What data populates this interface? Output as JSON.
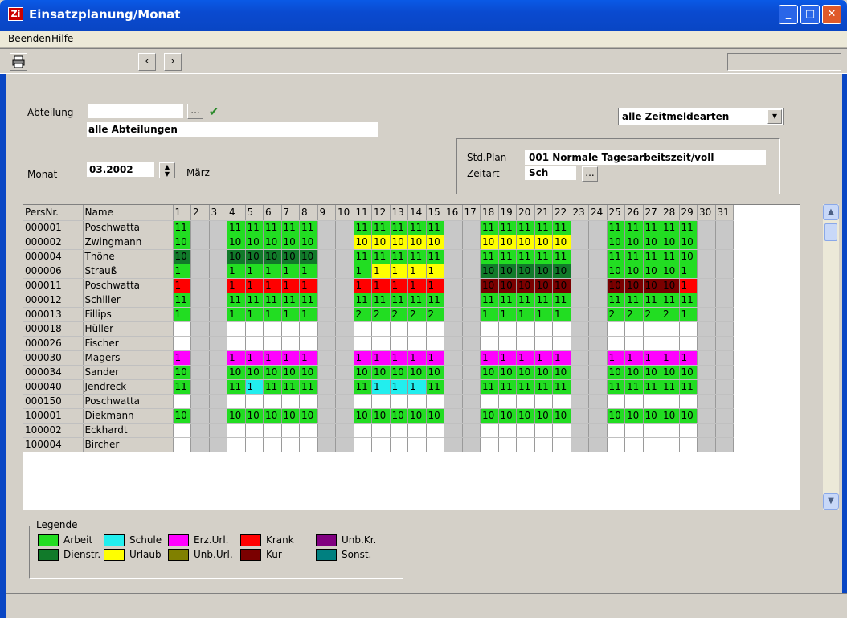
{
  "window": {
    "title": "Einsatzplanung/Monat",
    "app_icon_label": "Zi"
  },
  "menu": [
    "Beenden",
    "Hilfe"
  ],
  "filters": {
    "abteilung_label": "Abteilung",
    "abteilung_value": "",
    "abteilung_name": "alle Abteilungen",
    "monat_label": "Monat",
    "monat_value": "03.2002",
    "monat_name": "März",
    "zeitmeldeart": "alle Zeitmeldearten",
    "stdplan_label": "Std.Plan",
    "stdplan_value": "001 Normale Tagesarbeitszeit/voll",
    "zeitart_label": "Zeitart",
    "zeitart_value": "Sch"
  },
  "grid": {
    "col_persnr": "PersNr.",
    "col_name": "Name",
    "days": [
      "1",
      "2",
      "3",
      "4",
      "5",
      "6",
      "7",
      "8",
      "9",
      "10",
      "11",
      "12",
      "13",
      "14",
      "15",
      "16",
      "17",
      "18",
      "19",
      "20",
      "21",
      "22",
      "23",
      "24",
      "25",
      "26",
      "27",
      "28",
      "29",
      "30",
      "31"
    ],
    "weekend_days": [
      2,
      3,
      9,
      10,
      16,
      17,
      23,
      24,
      30,
      31
    ],
    "colors": {
      "A": "#22dd22",
      "D": "#117a2a",
      "S": "#22eeee",
      "U": "#ffff00",
      "E": "#ff00ff",
      "UU": "#808000",
      "K": "#ff0000",
      "R": "#7a0000",
      "UK": "#800080",
      "SO": "#008080"
    },
    "rows": [
      {
        "id": "000001",
        "name": "Poschwatta",
        "type": "A",
        "val": "11",
        "special": {}
      },
      {
        "id": "000002",
        "name": "Zwingmann",
        "type": "A",
        "val": "10",
        "special": {
          "11": "U",
          "12": "U",
          "13": "U",
          "14": "U",
          "15": "U",
          "18": "U",
          "19": "U",
          "20": "U",
          "21": "U",
          "22": "U"
        }
      },
      {
        "id": "000004",
        "name": "Thöne",
        "type": "A",
        "val": "10",
        "special": {
          "1": "D",
          "4": "D",
          "5": "D",
          "6": "D",
          "7": "D",
          "8": "D"
        },
        "vals": {
          "11": "11",
          "12": "11",
          "13": "11",
          "14": "11",
          "15": "11",
          "18": "11",
          "19": "11",
          "20": "11",
          "21": "11",
          "22": "11",
          "25": "11",
          "26": "11",
          "27": "11",
          "28": "11"
        }
      },
      {
        "id": "000006",
        "name": "Strauß",
        "type": "A",
        "val": "1",
        "special": {
          "12": "U",
          "13": "U",
          "14": "U",
          "15": "U",
          "18": "D",
          "19": "D",
          "20": "D",
          "21": "D",
          "22": "D"
        },
        "vals": {
          "18": "10",
          "19": "10",
          "20": "10",
          "21": "10",
          "22": "10",
          "25": "10",
          "26": "10",
          "27": "10",
          "28": "10"
        }
      },
      {
        "id": "000011",
        "name": "Poschwatta",
        "type": "K",
        "val": "1",
        "special": {
          "18": "R",
          "19": "R",
          "20": "R",
          "21": "R",
          "22": "R",
          "25": "R",
          "26": "R",
          "27": "R",
          "28": "R"
        },
        "vals": {
          "18": "10",
          "19": "10",
          "20": "10",
          "21": "10",
          "22": "10",
          "25": "10",
          "26": "10",
          "27": "10",
          "28": "10"
        }
      },
      {
        "id": "000012",
        "name": "Schiller",
        "type": "A",
        "val": "11",
        "special": {}
      },
      {
        "id": "000013",
        "name": "Fillips",
        "type": "A",
        "val": "1",
        "special": {},
        "vals": {
          "11": "2",
          "12": "2",
          "13": "2",
          "14": "2",
          "15": "2",
          "25": "2",
          "26": "2",
          "27": "2",
          "28": "2"
        }
      },
      {
        "id": "000018",
        "name": "Hüller",
        "type": "",
        "val": "",
        "special": {}
      },
      {
        "id": "000026",
        "name": "Fischer",
        "type": "",
        "val": "",
        "special": {}
      },
      {
        "id": "000030",
        "name": "Magers",
        "type": "E",
        "val": "1",
        "special": {}
      },
      {
        "id": "000034",
        "name": "Sander",
        "type": "A",
        "val": "10",
        "special": {}
      },
      {
        "id": "000040",
        "name": "Jendreck",
        "type": "A",
        "val": "11",
        "special": {
          "5": "S",
          "12": "S",
          "13": "S",
          "14": "S"
        },
        "vals": {
          "5": "1",
          "12": "1",
          "13": "1",
          "14": "1"
        }
      },
      {
        "id": "000150",
        "name": "Poschwatta",
        "type": "",
        "val": "",
        "special": {}
      },
      {
        "id": "100001",
        "name": "Diekmann",
        "type": "A",
        "val": "10",
        "special": {}
      },
      {
        "id": "100002",
        "name": "Eckhardt",
        "type": "",
        "val": "",
        "special": {}
      },
      {
        "id": "100004",
        "name": "Bircher",
        "type": "",
        "val": "",
        "special": {}
      }
    ]
  },
  "legend": {
    "title": "Legende",
    "items": [
      {
        "label": "Arbeit",
        "color": "#22dd22"
      },
      {
        "label": "Dienstr.",
        "color": "#117a2a"
      },
      {
        "label": "Schule",
        "color": "#22eeee"
      },
      {
        "label": "Urlaub",
        "color": "#ffff00"
      },
      {
        "label": "Erz.Url.",
        "color": "#ff00ff"
      },
      {
        "label": "Unb.Url.",
        "color": "#808000"
      },
      {
        "label": "Krank",
        "color": "#ff0000"
      },
      {
        "label": "Kur",
        "color": "#7a0000"
      },
      {
        "label": "Unb.Kr.",
        "color": "#800080"
      },
      {
        "label": "Sonst.",
        "color": "#008080"
      }
    ]
  },
  "icons": {
    "print": "printer-icon",
    "prev": "chevron-left-icon",
    "next": "chevron-right-icon",
    "confirm": "check-icon"
  }
}
